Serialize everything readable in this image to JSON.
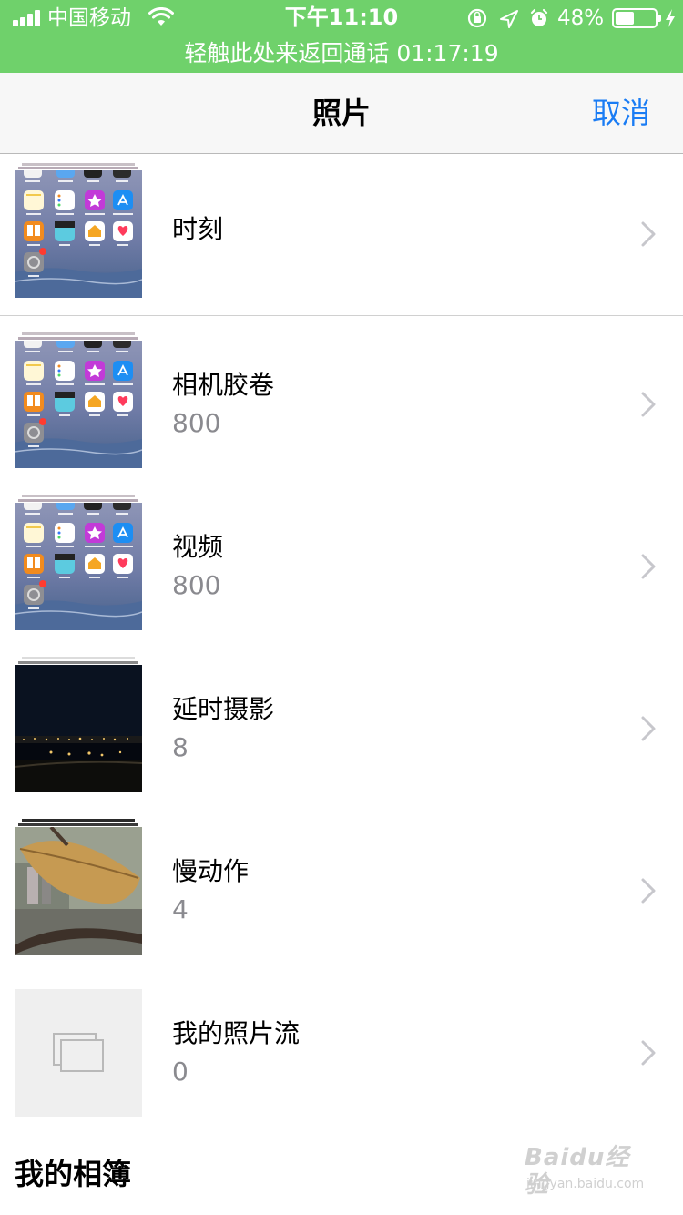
{
  "status_bar": {
    "carrier": "中国移动",
    "time": "下午11:10",
    "battery_percent": "48%",
    "battery_level": 0.48,
    "call_banner": "轻触此处来返回通话 01:17:19",
    "colors": {
      "background": "#6fd16b",
      "text": "#ffffff"
    }
  },
  "nav": {
    "title": "照片",
    "cancel": "取消",
    "accent_color": "#1a7cf4"
  },
  "albums": [
    {
      "title": "时刻",
      "count": "",
      "thumbnail": "home-screen",
      "icon": "chevron-right-icon"
    },
    {
      "title": "相机胶卷",
      "count": "800",
      "thumbnail": "home-screen",
      "icon": "chevron-right-icon"
    },
    {
      "title": "视频",
      "count": "800",
      "thumbnail": "home-screen",
      "icon": "chevron-right-icon"
    },
    {
      "title": "延时摄影",
      "count": "8",
      "thumbnail": "night-scene",
      "icon": "chevron-right-icon"
    },
    {
      "title": "慢动作",
      "count": "4",
      "thumbnail": "leaf-photo",
      "icon": "chevron-right-icon"
    },
    {
      "title": "我的照片流",
      "count": "0",
      "thumbnail": "photo-stream-placeholder",
      "icon": "chevron-right-icon"
    }
  ],
  "section_header": "我的相簿",
  "watermark": {
    "logo": "Baidu经验",
    "url": "jingyan.baidu.com"
  }
}
